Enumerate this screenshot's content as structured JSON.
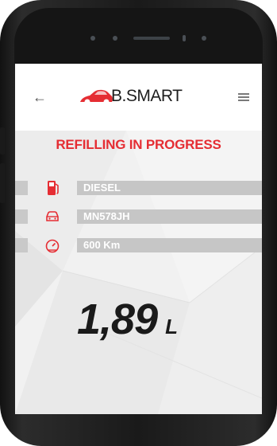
{
  "app": {
    "brand_prefix": "B.",
    "brand_name": "SMART",
    "back_symbol": "←"
  },
  "status": {
    "title": "REFILLING IN PROGRESS"
  },
  "vehicle_info": [
    {
      "icon": "fuel-pump-icon",
      "value": "DIESEL"
    },
    {
      "icon": "car-icon",
      "value": "MN578JH"
    },
    {
      "icon": "speedometer-icon",
      "value": "600 Km"
    }
  ],
  "refill": {
    "amount": "1,89",
    "unit": "L"
  },
  "colors": {
    "accent": "#e52d33",
    "bar": "#c6c6c6",
    "screen_bg": "#f1f1f1"
  }
}
